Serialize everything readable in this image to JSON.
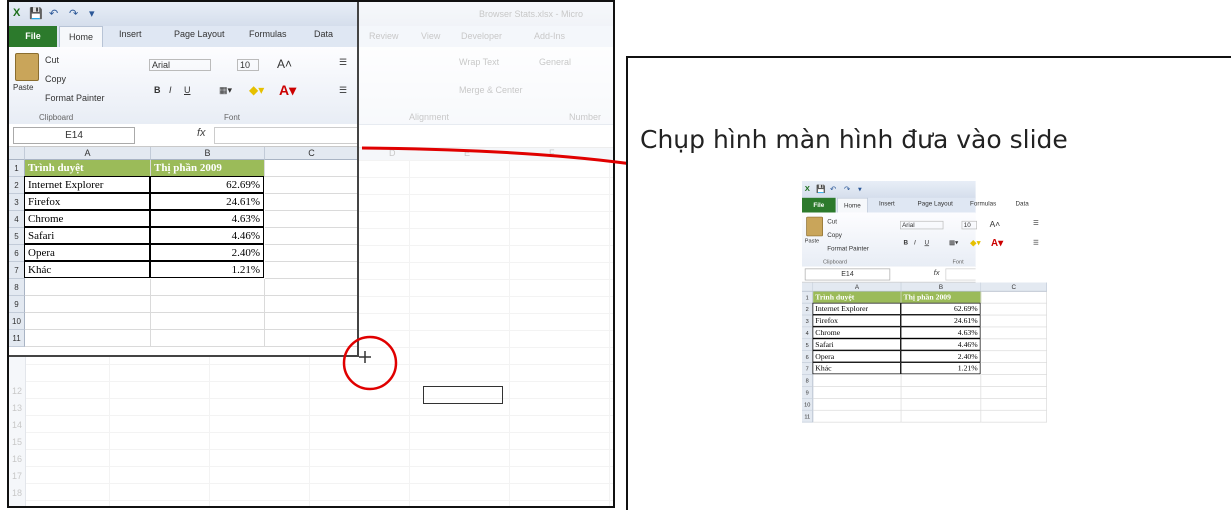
{
  "excel": {
    "quick_access": [
      "X",
      "💾",
      "↶",
      "↷",
      "▾"
    ],
    "title_faded": "Browser Stats.xlsx - Micro",
    "tabs": [
      "File",
      "Home",
      "Insert",
      "Page Layout",
      "Formulas",
      "Data"
    ],
    "tabs_faded": [
      "Review",
      "View",
      "Developer",
      "Add-Ins"
    ],
    "clipboard": {
      "paste": "Paste",
      "cut": "Cut",
      "copy": "Copy",
      "format_painter": "Format Painter",
      "group": "Clipboard"
    },
    "font": {
      "name": "Arial",
      "size": "10",
      "bold": "B",
      "italic": "I",
      "underline": "U",
      "group": "Font"
    },
    "ribbon_faded": {
      "wrap": "Wrap Text",
      "merge": "Merge & Center",
      "general": "General",
      "alignment": "Alignment",
      "number": "Number"
    },
    "name_box": "E14",
    "fx_label": "fx",
    "columns": [
      "A",
      "B",
      "C"
    ],
    "columns_faded": [
      "D",
      "E",
      "F"
    ],
    "rows": [
      "1",
      "2",
      "3",
      "4",
      "5",
      "6",
      "7",
      "8",
      "9",
      "10",
      "11"
    ],
    "rows_faded": [
      "12",
      "13",
      "14",
      "15",
      "16",
      "17",
      "18",
      "19",
      "20"
    ],
    "table_header": [
      "Trình duyệt",
      "Thị phần 2009"
    ],
    "table_rows": [
      [
        "Internet Explorer",
        "62.69%"
      ],
      [
        "Firefox",
        "24.61%"
      ],
      [
        "Chrome",
        "4.63%"
      ],
      [
        "Safari",
        "4.46%"
      ],
      [
        "Opera",
        "2.40%"
      ],
      [
        "Khác",
        "1.21%"
      ]
    ]
  },
  "slide": {
    "title": "Chụp hình màn hình đưa vào slide"
  },
  "colors": {
    "file_tab": "#2c7a2c",
    "header_fill": "#9bbb59",
    "annotation": "#e00000"
  }
}
